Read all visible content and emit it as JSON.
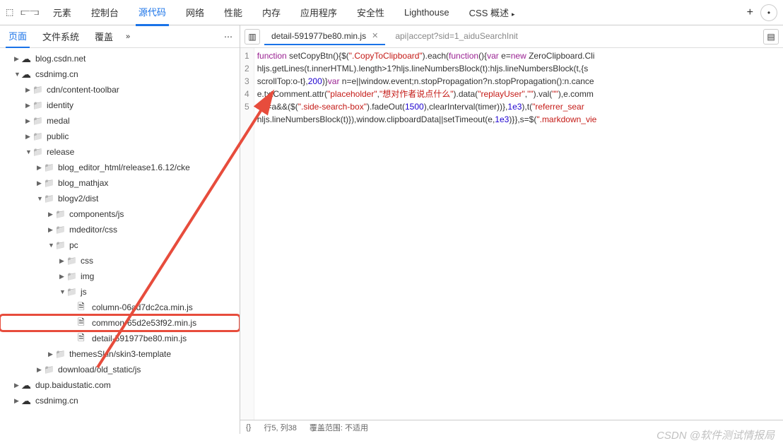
{
  "topTabs": [
    "元素",
    "控制台",
    "源代码",
    "网络",
    "性能",
    "内存",
    "应用程序",
    "安全性",
    "Lighthouse",
    "CSS 概述"
  ],
  "topActive": 2,
  "leftTabs": [
    "页面",
    "文件系统",
    "覆盖"
  ],
  "leftActive": 0,
  "tree": [
    {
      "d": 1,
      "t": "cloud",
      "exp": false,
      "label": "blog.csdn.net"
    },
    {
      "d": 1,
      "t": "cloud",
      "exp": true,
      "label": "csdnimg.cn"
    },
    {
      "d": 2,
      "t": "folder",
      "exp": false,
      "label": "cdn/content-toolbar"
    },
    {
      "d": 2,
      "t": "folder",
      "exp": false,
      "label": "identity"
    },
    {
      "d": 2,
      "t": "folder",
      "exp": false,
      "label": "medal"
    },
    {
      "d": 2,
      "t": "folder",
      "exp": false,
      "label": "public"
    },
    {
      "d": 2,
      "t": "folder",
      "exp": true,
      "label": "release"
    },
    {
      "d": 3,
      "t": "folder",
      "exp": false,
      "label": "blog_editor_html/release1.6.12/cke"
    },
    {
      "d": 3,
      "t": "folder",
      "exp": false,
      "label": "blog_mathjax"
    },
    {
      "d": 3,
      "t": "folder",
      "exp": true,
      "label": "blogv2/dist"
    },
    {
      "d": 4,
      "t": "folder",
      "exp": false,
      "label": "components/js"
    },
    {
      "d": 4,
      "t": "folder",
      "exp": false,
      "label": "mdeditor/css"
    },
    {
      "d": 4,
      "t": "folder",
      "exp": true,
      "label": "pc"
    },
    {
      "d": 5,
      "t": "folder",
      "exp": false,
      "label": "css"
    },
    {
      "d": 5,
      "t": "folder",
      "exp": false,
      "label": "img"
    },
    {
      "d": 5,
      "t": "folder",
      "exp": true,
      "label": "js"
    },
    {
      "d": 6,
      "t": "file",
      "exp": null,
      "label": "column-06ad7dc2ca.min.js"
    },
    {
      "d": 6,
      "t": "file",
      "exp": null,
      "label": "common-65d2e53f92.min.js",
      "hl": true
    },
    {
      "d": 6,
      "t": "file",
      "exp": null,
      "label": "detail-591977be80.min.js"
    },
    {
      "d": 4,
      "t": "folder",
      "exp": false,
      "label": "themesSkin/skin3-template"
    },
    {
      "d": 3,
      "t": "folder",
      "exp": false,
      "label": "download/old_static/js"
    },
    {
      "d": 1,
      "t": "cloud",
      "exp": false,
      "label": "dup.baidustatic.com"
    },
    {
      "d": 1,
      "t": "cloud",
      "exp": false,
      "label": "csdnimg.cn"
    }
  ],
  "editorTabs": [
    {
      "label": "detail-591977be80.min.js",
      "active": true
    },
    {
      "label": "api|accept?sid=1_aiduSearchInit",
      "active": false
    }
  ],
  "code": {
    "lines": [
      1,
      2,
      3,
      4,
      5
    ],
    "l1": {
      "a": "function",
      "b": " setCopyBtn(){$(",
      "c": "\".CopyToClipboard\"",
      "d": ").each(",
      "e": "function",
      "f": "(){",
      "g": "var",
      "h": " e=",
      "i": "new",
      "j": " ZeroClipboard.Cli"
    },
    "l2": {
      "a": "hljs.getLines(t.innerHTML).length>1?hljs.lineNumbersBlock(t):hljs.lineNumbersBlock(t,{s"
    },
    "l3": {
      "a": "scrollTop:o-t},",
      "b": "200",
      "c": ")}",
      "d": "var",
      "e": " n=e||window.event;n.stopPropagation?n.stopPropagation():n.cance"
    },
    "l4": {
      "a": "e.txtComment.attr(",
      "b": "\"placeholder\"",
      "c": ",",
      "d": "\"想对作者说点什么\"",
      "e": ").data(",
      "f": "\"replayUser\"",
      "g": ",",
      "h": "\"\"",
      "i": ").val(",
      "j": "\"\"",
      "k": "),e.comm"
    },
    "l5": {
      "a": "7==a&&($(",
      "b": "\".side-search-box\"",
      "c": ").fadeOut(",
      "d": "1500",
      "e": "),clearInterval(timer))},",
      "f": "1e3",
      "g": "),t(",
      "h": "\"referrer_sear"
    },
    "l6": {
      "a": "hljs.lineNumbersBlock(t)}),window.clipboardData||setTimeout(e,",
      "b": "1e3",
      "c": ")}},s=$(",
      "d": "\".markdown_vie"
    }
  },
  "status": {
    "braces": "{}",
    "pos": "行5, 列38",
    "coverage": "覆盖范围: 不适用"
  },
  "watermark": "CSDN @软件测试情报局"
}
